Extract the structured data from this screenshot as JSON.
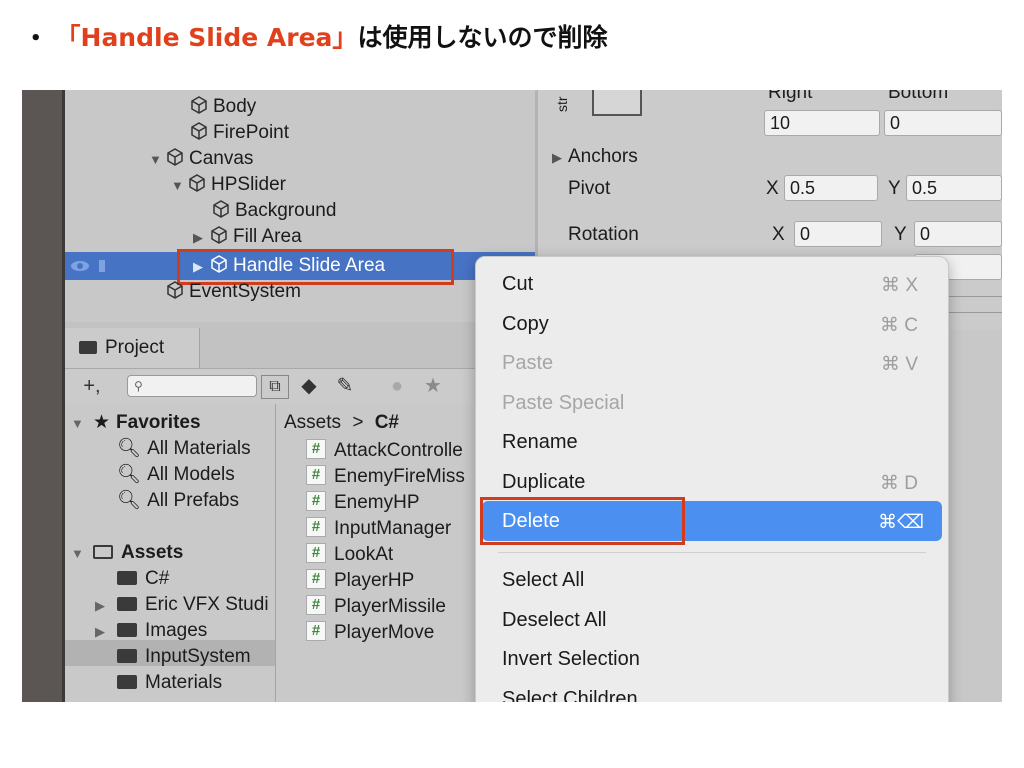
{
  "caption": {
    "bullet": "•",
    "highlight": "「Handle Slide Area」",
    "rest": "は使用しないので削除"
  },
  "hierarchy": {
    "items": [
      {
        "label": "Body"
      },
      {
        "label": "FirePoint"
      },
      {
        "label": "Canvas"
      },
      {
        "label": "HPSlider"
      },
      {
        "label": "Background"
      },
      {
        "label": "Fill Area"
      },
      {
        "label": "Handle Slide Area"
      },
      {
        "label": "EventSystem"
      }
    ]
  },
  "inspector": {
    "str_label": "str",
    "right_label": "Right",
    "bottom_label": "Bottom",
    "right_value": "10",
    "bottom_value": "0",
    "anchors_label": "Anchors",
    "pivot_label": "Pivot",
    "pivot_x_label": "X",
    "pivot_x": "0.5",
    "pivot_y_label": "Y",
    "pivot_y": "0.5",
    "rotation_label": "Rotation",
    "rot_x_label": "X",
    "rot_x": "0",
    "rot_y_label": "Y",
    "rot_y": "0"
  },
  "project": {
    "tab_label": "Project",
    "add_label": "+,",
    "favorites_label": "Favorites",
    "favorites": [
      "All Materials",
      "All Models",
      "All Prefabs"
    ],
    "assets_label": "Assets",
    "folders": [
      "C#",
      "Eric VFX Studi",
      "Images",
      "InputSystem",
      "Materials"
    ],
    "breadcrumb_root": "Assets",
    "breadcrumb_sep": ">",
    "breadcrumb_current": "C#",
    "files": [
      "AttackControlle",
      "EnemyFireMiss",
      "EnemyHP",
      "InputManager",
      "LookAt",
      "PlayerHP",
      "PlayerMissile",
      "PlayerMove"
    ]
  },
  "context_menu": {
    "items": [
      {
        "label": "Cut",
        "shortcut": "⌘ X",
        "disabled": false
      },
      {
        "label": "Copy",
        "shortcut": "⌘ C",
        "disabled": false
      },
      {
        "label": "Paste",
        "shortcut": "⌘ V",
        "disabled": true
      },
      {
        "label": "Paste Special",
        "shortcut": "",
        "disabled": true
      },
      {
        "label": "Rename",
        "shortcut": "",
        "disabled": false
      },
      {
        "label": "Duplicate",
        "shortcut": "⌘ D",
        "disabled": false
      },
      {
        "label": "Delete",
        "shortcut": "⌘⌫",
        "disabled": false
      },
      {
        "label": "Select All",
        "shortcut": "",
        "disabled": false
      },
      {
        "label": "Deselect All",
        "shortcut": "",
        "disabled": false
      },
      {
        "label": "Invert Selection",
        "shortcut": "",
        "disabled": false
      },
      {
        "label": "Select Children",
        "shortcut": "",
        "disabled": false
      }
    ]
  },
  "colors": {
    "accent_red": "#d23c1e",
    "selection_blue": "#4773c4",
    "menu_highlight": "#4b8ff0"
  }
}
